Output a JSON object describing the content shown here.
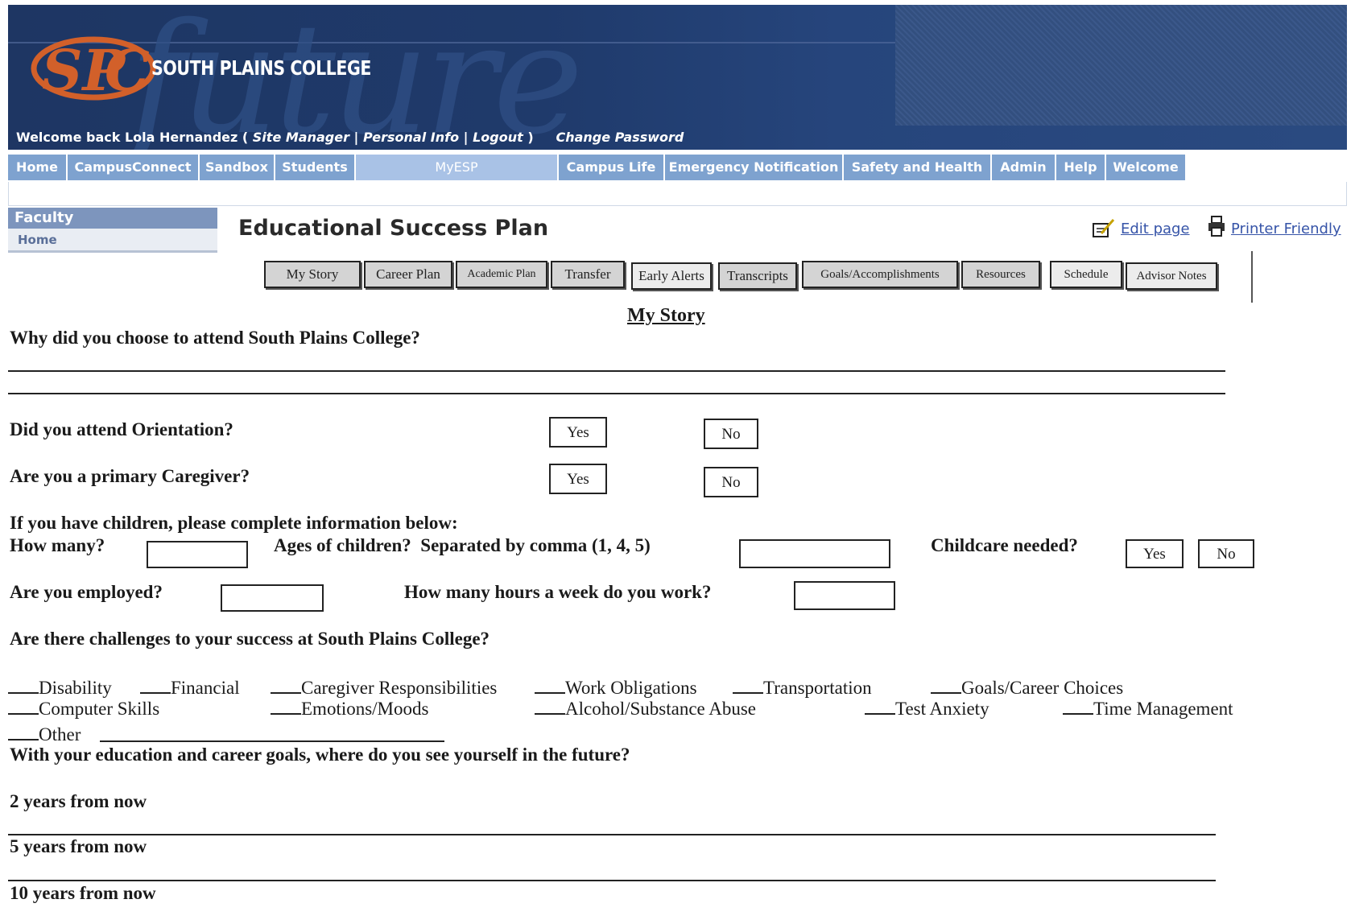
{
  "header": {
    "college_name": "SOUTH PLAINS COLLEGE",
    "logo_letters": "SPC",
    "welcome_prefix": "Welcome back",
    "user_name": "Lola Hernandez",
    "open_paren": "(",
    "site_manager": "Site Manager",
    "sep1": "|",
    "personal_info": "Personal Info",
    "sep2": "|",
    "logout": "Logout",
    "close_paren": ")",
    "change_password": "Change Password"
  },
  "nav": {
    "tabs": [
      {
        "label": "Home"
      },
      {
        "label": "CampusConnect"
      },
      {
        "label": "Sandbox"
      },
      {
        "label": "Students"
      },
      {
        "label": "MyESP"
      },
      {
        "label": "Campus Life"
      },
      {
        "label": "Emergency Notification"
      },
      {
        "label": "Safety and Health"
      },
      {
        "label": "Admin"
      },
      {
        "label": "Help"
      },
      {
        "label": "Welcome"
      }
    ]
  },
  "sidebar": {
    "heading": "Faculty",
    "item": "Home"
  },
  "page": {
    "title": "Educational Success Plan",
    "edit_page": "Edit page",
    "printer_friendly": "Printer Friendly"
  },
  "sub_tabs": [
    {
      "label": "My Story"
    },
    {
      "label": "Career Plan"
    },
    {
      "label": "Academic Plan"
    },
    {
      "label": "Transfer"
    },
    {
      "label": "Early Alerts"
    },
    {
      "label": "Transcripts"
    },
    {
      "label": "Goals/Accomplishments"
    },
    {
      "label": "Resources"
    },
    {
      "label": "Schedule"
    },
    {
      "label": "Advisor Notes"
    }
  ],
  "form": {
    "section_title": "My Story",
    "q_why": "Why did you choose to attend South Plains College?",
    "q_orientation": "Did you attend Orientation?",
    "q_caregiver": "Are you a primary Caregiver?",
    "yes": "Yes",
    "no": "No",
    "children_intro": "If you have children, please complete information below:",
    "how_many": "How many?",
    "ages": "Ages of children?  Separated by comma (1, 4, 5)",
    "childcare": "Childcare needed?",
    "employed": "Are you employed?",
    "hours": "How many hours a week do you work?",
    "challenges": "Are there challenges to your success at South Plains College?",
    "options": {
      "disability": "Disability",
      "financial": "Financial",
      "caregiver_resp": "Caregiver Responsibilities",
      "work": "Work Obligations",
      "transportation": "Transportation",
      "goals": "Goals/Career Choices",
      "computer": "Computer Skills",
      "emotions": "Emotions/Moods",
      "alcohol": "Alcohol/Substance Abuse",
      "test_anxiety": "Test Anxiety",
      "time_mgmt": "Time Management",
      "other": "Other"
    },
    "future": "With your education and career goals, where do you see yourself in the future?",
    "two_years": "2 years from now",
    "five_years": "5 years from now",
    "ten_years": "10 years from now"
  }
}
